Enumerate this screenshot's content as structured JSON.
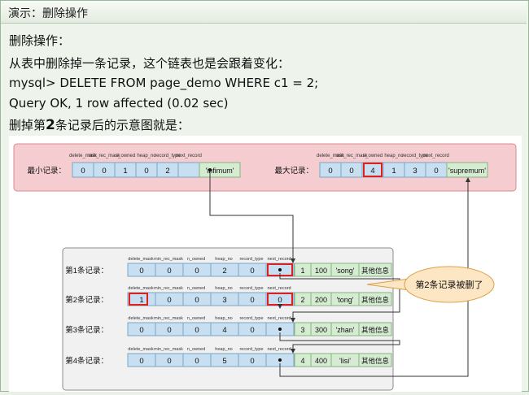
{
  "window": {
    "title": "演示：删除操作"
  },
  "text": {
    "heading": "删除操作：",
    "desc": "从表中删除掉一条记录，这个链表也是会跟着变化：",
    "sql": "mysql> DELETE FROM page_demo WHERE c1 = 2;",
    "result": "Query OK, 1 row affected (0.02 sec)",
    "caption_pre": "删掉第",
    "caption_num": "2",
    "caption_post": "条记录后的示意图就是："
  },
  "diagram": {
    "headers": [
      "delete_mask",
      "min_rec_mask",
      "n_owned",
      "heap_no",
      "record_type",
      "next_record"
    ],
    "min_record": {
      "label": "最小记录：",
      "values": [
        "0",
        "0",
        "1",
        "0",
        "2",
        ""
      ],
      "name": "'infimum'"
    },
    "max_record": {
      "label": "最大记录：",
      "values": [
        "0",
        "0",
        "4",
        "1",
        "3",
        "0"
      ],
      "name": "'supremum'"
    },
    "records": [
      {
        "label": "第1条记录：",
        "values": [
          "0",
          "0",
          "0",
          "2",
          "0",
          "",
          "1",
          "100",
          "'song'"
        ],
        "other": "其他信息"
      },
      {
        "label": "第2条记录：",
        "values": [
          "1",
          "0",
          "0",
          "3",
          "0",
          "0",
          "2",
          "200",
          "'tong'"
        ],
        "other": "其他信息"
      },
      {
        "label": "第3条记录：",
        "values": [
          "0",
          "0",
          "0",
          "4",
          "0",
          "",
          "3",
          "300",
          "'zhan'"
        ],
        "other": "其他信息"
      },
      {
        "label": "第4条记录：",
        "values": [
          "0",
          "0",
          "0",
          "5",
          "0",
          "",
          "4",
          "400",
          "'lisi'"
        ],
        "other": "其他信息"
      }
    ],
    "callout": "第2条记录被删了",
    "colors": {
      "header_fill": "#c7dff0",
      "data_fill": "#d6ecd2",
      "top_panel": "#f5cdd0",
      "highlight": "#e02020"
    }
  }
}
